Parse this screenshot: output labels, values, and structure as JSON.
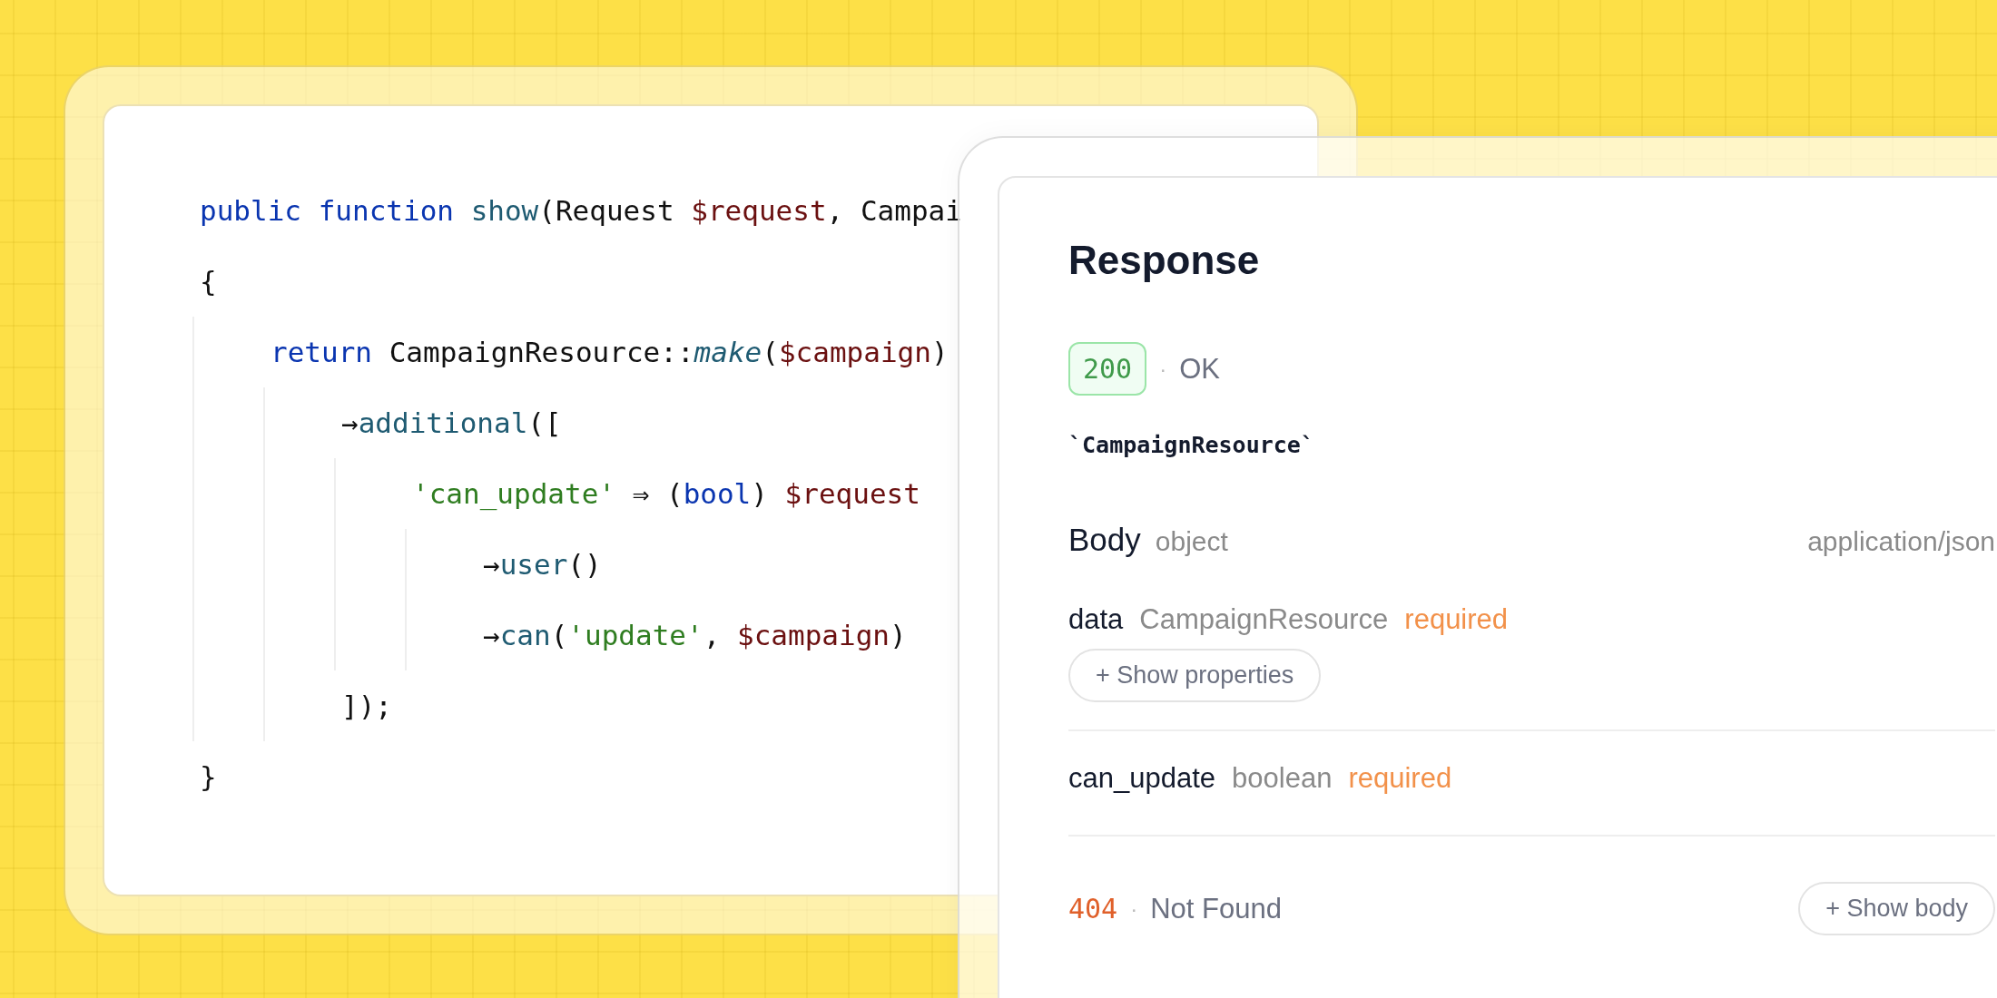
{
  "code_card": {
    "lines": [
      {
        "tokens": [
          {
            "kind": "keyword",
            "text": "public function"
          },
          {
            "kind": "function",
            "text": " show"
          },
          {
            "kind": "plain",
            "text": "(Request "
          },
          {
            "kind": "variable",
            "text": "$request"
          },
          {
            "kind": "plain",
            "text": ", Campai"
          }
        ]
      },
      {
        "tokens": [
          {
            "kind": "plain",
            "text": "{"
          }
        ],
        "children": [
          {
            "tokens": [
              {
                "kind": "keyword",
                "text": "return"
              },
              {
                "kind": "plain",
                "text": " CampaignResource::"
              },
              {
                "kind": "static",
                "text": "make"
              },
              {
                "kind": "plain",
                "text": "("
              },
              {
                "kind": "variable",
                "text": "$campaign"
              },
              {
                "kind": "plain",
                "text": ")"
              }
            ],
            "children": [
              {
                "tokens": [
                  {
                    "kind": "plain",
                    "text": "→"
                  },
                  {
                    "kind": "function",
                    "text": "additional"
                  },
                  {
                    "kind": "plain",
                    "text": "(["
                  }
                ],
                "children": [
                  {
                    "tokens": [
                      {
                        "kind": "string",
                        "text": "'can_update'"
                      },
                      {
                        "kind": "plain",
                        "text": " ⇒ ("
                      },
                      {
                        "kind": "keyword",
                        "text": "bool"
                      },
                      {
                        "kind": "plain",
                        "text": ") "
                      },
                      {
                        "kind": "variable",
                        "text": "$request"
                      }
                    ],
                    "children": [
                      {
                        "tokens": [
                          {
                            "kind": "plain",
                            "text": "→"
                          },
                          {
                            "kind": "function",
                            "text": "user"
                          },
                          {
                            "kind": "plain",
                            "text": "()"
                          }
                        ]
                      },
                      {
                        "tokens": [
                          {
                            "kind": "plain",
                            "text": "→"
                          },
                          {
                            "kind": "function",
                            "text": "can"
                          },
                          {
                            "kind": "plain",
                            "text": "("
                          },
                          {
                            "kind": "string",
                            "text": "'update'"
                          },
                          {
                            "kind": "plain",
                            "text": ", "
                          },
                          {
                            "kind": "variable",
                            "text": "$campaign"
                          },
                          {
                            "kind": "plain",
                            "text": ")"
                          }
                        ]
                      }
                    ]
                  }
                ]
              },
              {
                "tokens": [
                  {
                    "kind": "plain",
                    "text": "]);"
                  }
                ]
              }
            ]
          }
        ]
      },
      {
        "tokens": [
          {
            "kind": "plain",
            "text": "}"
          }
        ]
      }
    ]
  },
  "response_panel": {
    "title": "Response",
    "statuses": [
      {
        "kind": "success",
        "code": "200",
        "separator": "·",
        "text": "OK",
        "resource": "`CampaignResource`",
        "body": {
          "label": "Body",
          "type": "object",
          "content_type": "application/json",
          "fields": [
            {
              "name": "data",
              "type": "CampaignResource",
              "required": "required",
              "button": "+ Show properties"
            },
            {
              "name": "can_update",
              "type": "boolean",
              "required": "required"
            }
          ]
        }
      },
      {
        "kind": "error",
        "code": "404",
        "separator": "·",
        "text": "Not Found",
        "button": "+ Show body"
      }
    ]
  }
}
